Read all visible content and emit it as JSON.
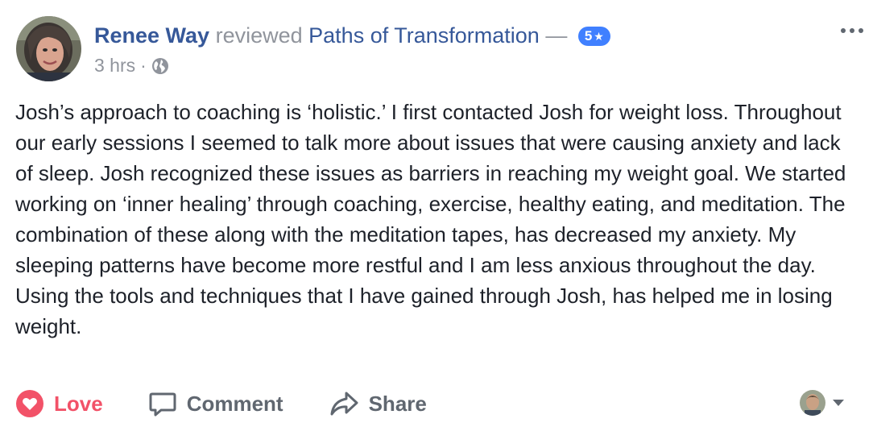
{
  "review": {
    "author": "Renee Way",
    "verb": "reviewed",
    "page": "Paths of Transformation",
    "dash": "—",
    "rating": "5",
    "star_glyph": "★",
    "timestamp": "3 hrs",
    "separator": "·",
    "audience_icon": "globe-icon",
    "body": "Josh’s approach to coaching is ‘holistic.’ I first contacted Josh for weight loss. Throughout our early sessions I seemed to talk more about issues that were causing anxiety and lack of sleep. Josh recognized these issues as barriers in reaching my weight goal. We started working on ‘inner healing’ through coaching, exercise, healthy eating, and meditation. The combination of these along with the meditation tapes, has decreased my anxiety. My sleeping patterns have become more restful and I am less anxious throughout the day. Using the tools and techniques that I have gained through Josh, has helped me in losing weight."
  },
  "actions": {
    "love_label": "Love",
    "comment_label": "Comment",
    "share_label": "Share"
  },
  "colors": {
    "link": "#365899",
    "muted": "#90949c",
    "love": "#f25268",
    "badge": "#4080ff",
    "action_text": "#606770"
  }
}
